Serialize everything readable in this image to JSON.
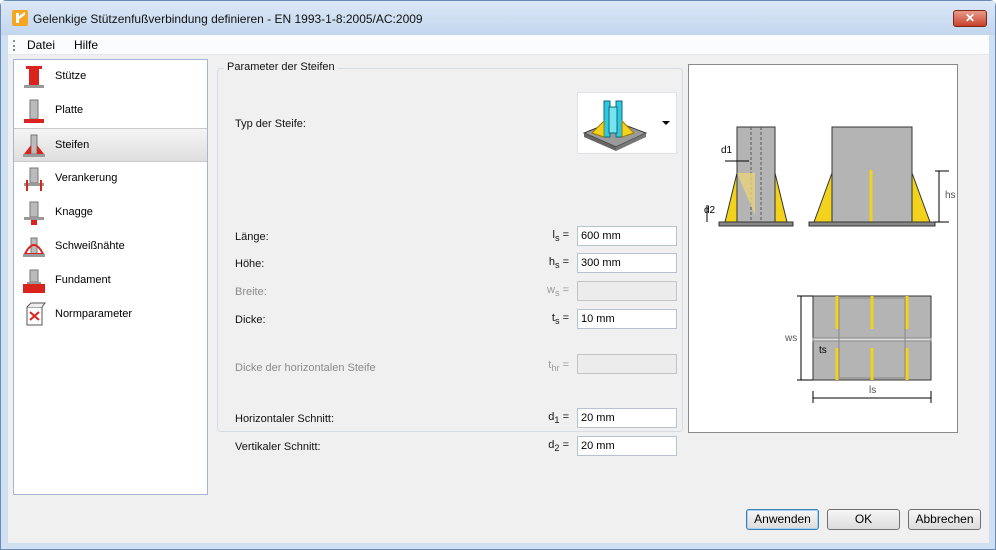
{
  "window": {
    "title": "Gelenkige Stützenfußverbindung definieren - EN 1993-1-8:2005/AC:2009",
    "close_label": "✕"
  },
  "menu": [
    "Datei",
    "Hilfe"
  ],
  "nav": {
    "items": [
      {
        "label": "Stütze",
        "icon": "column-icon"
      },
      {
        "label": "Platte",
        "icon": "plate-icon"
      },
      {
        "label": "Steifen",
        "icon": "stiffener-icon"
      },
      {
        "label": "Verankerung",
        "icon": "anchorage-icon"
      },
      {
        "label": "Knagge",
        "icon": "shear-key-icon"
      },
      {
        "label": "Schweißnähte",
        "icon": "welds-icon"
      },
      {
        "label": "Fundament",
        "icon": "foundation-icon"
      },
      {
        "label": "Normparameter",
        "icon": "code-parameters-icon"
      }
    ],
    "selected": "Steifen"
  },
  "params": {
    "group_title": "Parameter der Steifen",
    "type_label": "Typ der Steife:",
    "laenge": {
      "label": "Länge:",
      "sym": "l",
      "sub": "s",
      "value": "600 mm"
    },
    "hoehe": {
      "label": "Höhe:",
      "sym": "h",
      "sub": "s",
      "value": "300 mm"
    },
    "breite": {
      "label": "Breite:",
      "sym": "w",
      "sub": "s",
      "value": ""
    },
    "dicke": {
      "label": "Dicke:",
      "sym": "t",
      "sub": "s",
      "value": "10 mm"
    },
    "dicke_hor": {
      "label": "Dicke der horizontalen Steife",
      "sym": "t",
      "sub": "hr",
      "value": ""
    },
    "hor_schnitt": {
      "label": "Horizontaler Schnitt:",
      "sym": "d",
      "sub": "1",
      "value": "20 mm"
    },
    "vert_schnitt": {
      "label": "Vertikaler Schnitt:",
      "sym": "d",
      "sub": "2",
      "value": "20 mm"
    }
  },
  "preview_labels": {
    "d1": "d1",
    "d2": "d2",
    "hs": "hs",
    "ws": "ws",
    "ts": "ts",
    "ls": "ls"
  },
  "buttons": {
    "apply": "Anwenden",
    "ok": "OK",
    "cancel": "Abbrechen"
  },
  "colors": {
    "accent_yellow": "#f2d21b",
    "steel_gray": "#b4b4b4",
    "nav_red": "#d9231c"
  }
}
